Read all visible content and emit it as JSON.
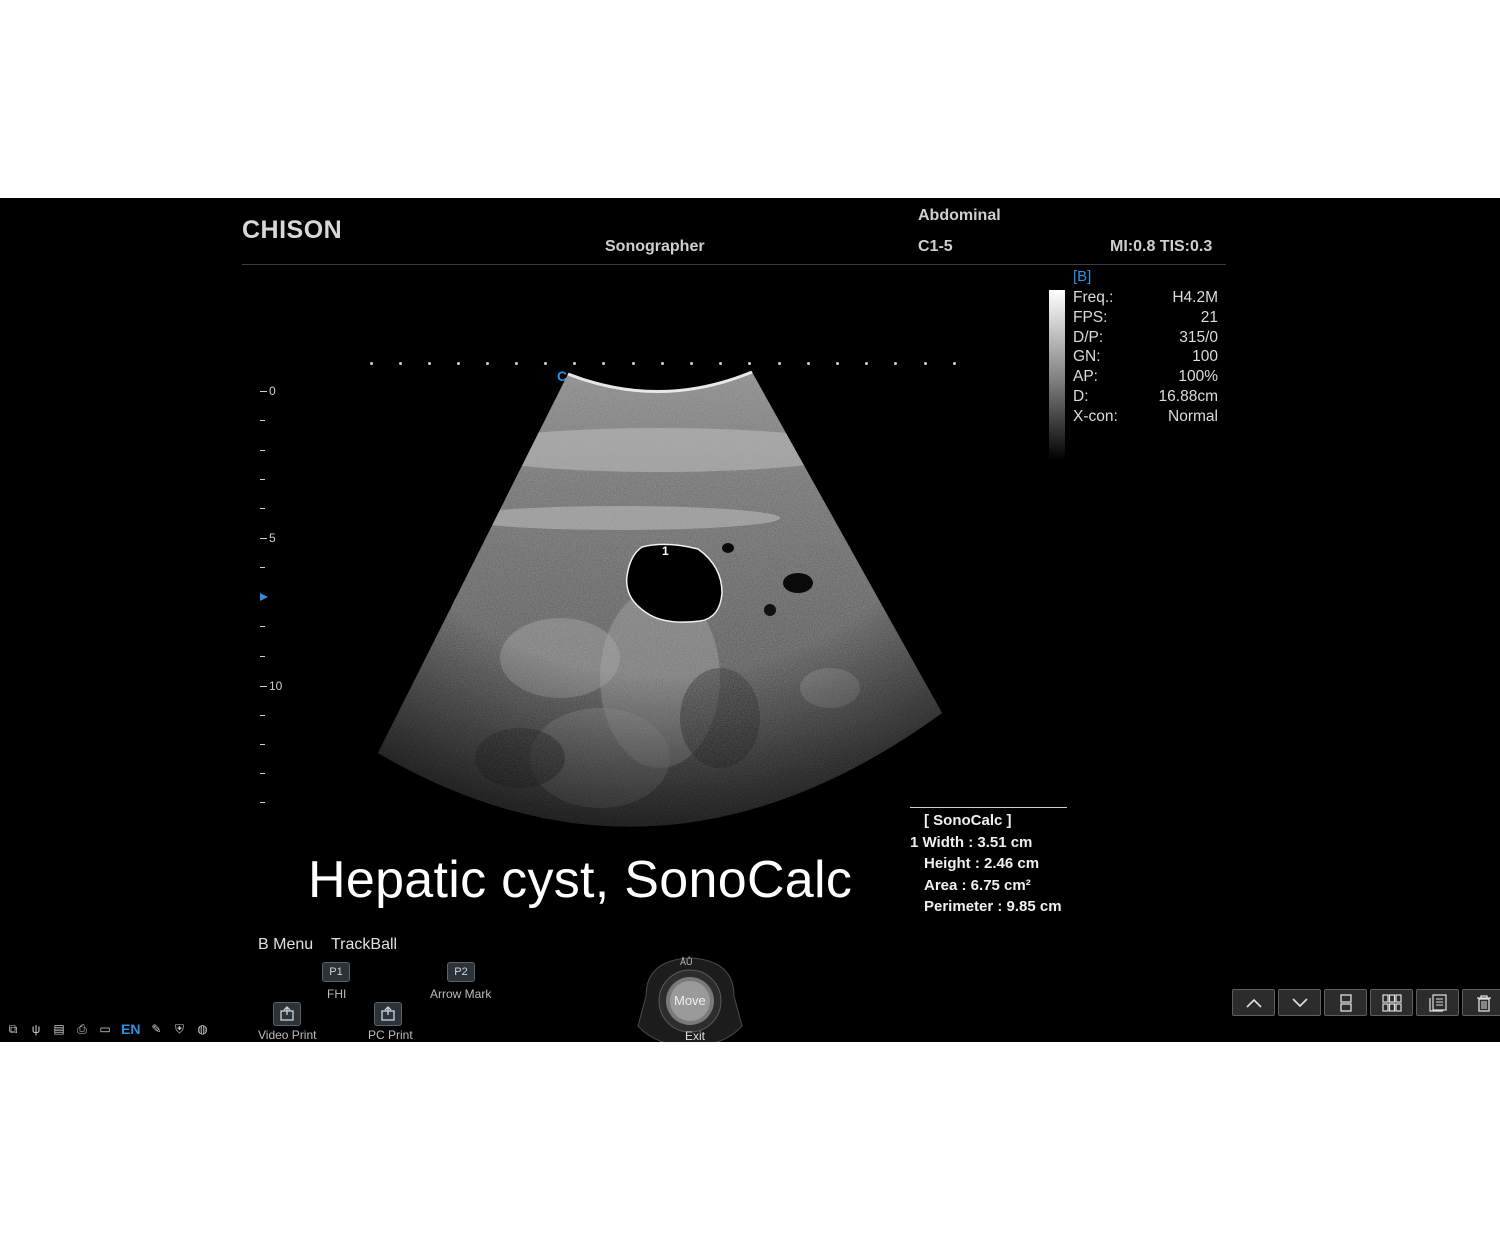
{
  "header": {
    "brand": "CHISON",
    "preset": "Abdominal",
    "operator": "Sonographer",
    "probe": "C1-5",
    "indices": "MI:0.8 TIS:0.3"
  },
  "params": {
    "mode": "[B]",
    "rows": [
      {
        "label": "Freq.:",
        "value": "H4.2M"
      },
      {
        "label": "FPS:",
        "value": "21"
      },
      {
        "label": "D/P:",
        "value": "315/0"
      },
      {
        "label": "GN:",
        "value": "100"
      },
      {
        "label": "AP:",
        "value": "100%"
      },
      {
        "label": "D:",
        "value": "16.88cm"
      },
      {
        "label": "X-con:",
        "value": "Normal"
      }
    ]
  },
  "depth_scale": {
    "labels": [
      "0",
      "5",
      "10"
    ]
  },
  "image": {
    "orientation_mark": "C",
    "caption": "Hepatic cyst, SonoCalc",
    "roi_label": "1"
  },
  "sonocalc": {
    "title": "[ SonoCalc ]",
    "lines": [
      "1 Width :  3.51 cm",
      "Height :  2.46 cm",
      "Area :  6.75 cm²",
      "Perimeter : 9.85 cm"
    ]
  },
  "menu": {
    "b_menu": "B Menu",
    "trackball": "TrackBall",
    "p1": "P1",
    "p1_label": "FHI",
    "p2": "P2",
    "p2_label": "Arrow Mark",
    "video_print": "Video Print",
    "pc_print": "PC Print",
    "tb_top": "ÅŮ",
    "tb_center": "Move",
    "tb_bottom": "Exit"
  },
  "tray": {
    "language": "EN"
  },
  "colors": {
    "accent": "#2f8fe0",
    "background": "#000000"
  }
}
